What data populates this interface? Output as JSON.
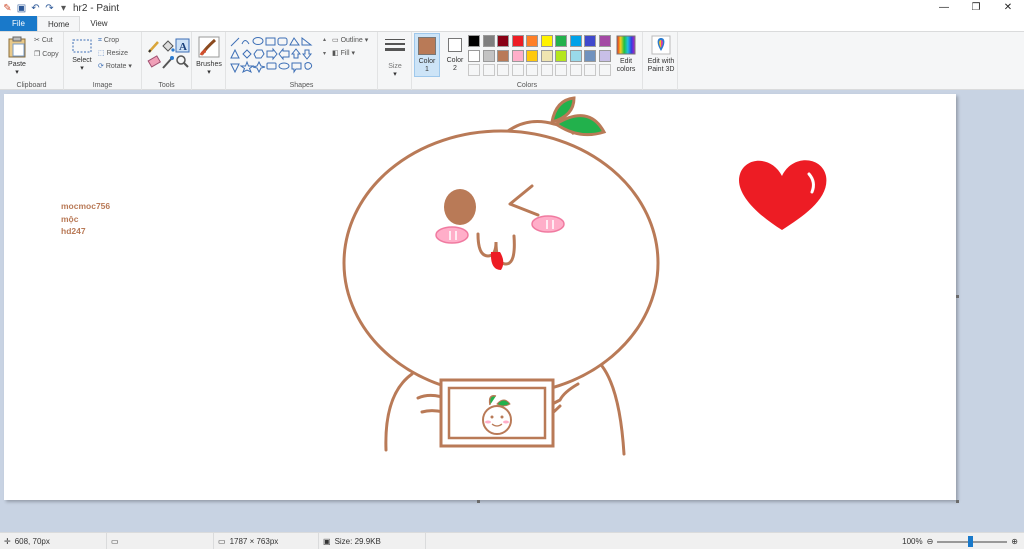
{
  "window": {
    "title": "hr2 - Paint",
    "minimize": "—",
    "maximize": "❐",
    "close": "✕"
  },
  "tabs": [
    {
      "label": "File"
    },
    {
      "label": "Home"
    },
    {
      "label": "View"
    }
  ],
  "ribbon": {
    "clipboard": {
      "label": "Clipboard",
      "paste": "Paste",
      "cut": "Cut",
      "copy": "Copy"
    },
    "image": {
      "label": "Image",
      "select": "Select",
      "crop": "Crop",
      "resize": "Resize",
      "rotate": "Rotate"
    },
    "tools": {
      "label": "Tools"
    },
    "brushes": {
      "label": "Brushes"
    },
    "shapes": {
      "label": "Shapes",
      "outline": "Outline",
      "fill": "Fill"
    },
    "size": {
      "label": "Size"
    },
    "colors": {
      "label": "Colors",
      "color1": "Color\n1",
      "color1_l1": "Color",
      "color1_l2": "1",
      "color2_l1": "Color",
      "color2_l2": "2",
      "color1_value": "#b97a57",
      "color2_value": "#ffffff",
      "edit_l1": "Edit",
      "edit_l2": "colors",
      "paint3d_l1": "Edit with",
      "paint3d_l2": "Paint 3D",
      "row1": [
        "#000000",
        "#7f7f7f",
        "#880015",
        "#ed1c24",
        "#ff7f27",
        "#fff200",
        "#22b14c",
        "#00a2e8",
        "#3f48cc",
        "#a349a4"
      ],
      "row2": [
        "#ffffff",
        "#c3c3c3",
        "#b97a57",
        "#ffaec9",
        "#ffc90e",
        "#efe4b0",
        "#b5e61d",
        "#99d9ea",
        "#7092be",
        "#c8bfe7"
      ]
    }
  },
  "canvas": {
    "text_lines": [
      "mocmoc756",
      "mộc",
      "hd247"
    ],
    "brown": "#b97a57",
    "green": "#22b14c",
    "red": "#ed1c24",
    "pink": "#ffaec9"
  },
  "status": {
    "cursor": "608, 70px",
    "dimensions": "1787 × 763px",
    "size": "Size: 29.9KB",
    "zoom": "100%"
  }
}
